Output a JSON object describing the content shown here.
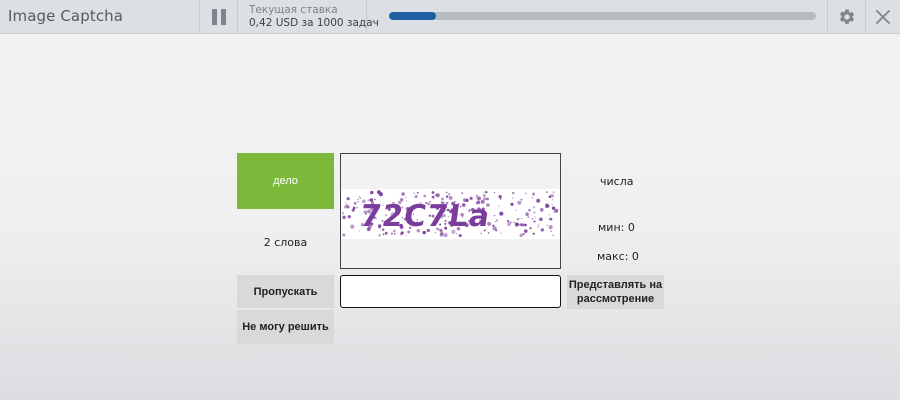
{
  "window": {
    "title": "Image Captcha"
  },
  "rate": {
    "label": "Текущая ставка",
    "value": "0,42 USD за 1000 задач"
  },
  "progress": {
    "fraction": 0.11
  },
  "task": {
    "word_label": "дело",
    "words_count": "2 слова",
    "captcha_text": "72C7La",
    "type_label": "числа",
    "min_label": "мин: 0",
    "max_label": "макс: 0",
    "answer": {
      "value": "",
      "placeholder": ""
    }
  },
  "buttons": {
    "skip": "Пропускать",
    "cannot_solve": "Не могу решить",
    "submit_review": "Представлять на рассмотрение"
  },
  "colors": {
    "accent_green": "#7cb83a",
    "progress_blue": "#1d5fa3",
    "captcha_purple": "#7b3d9b",
    "topbar": "#dcdfe3"
  },
  "icons": [
    "pause-icon",
    "gear-icon",
    "close-icon"
  ]
}
